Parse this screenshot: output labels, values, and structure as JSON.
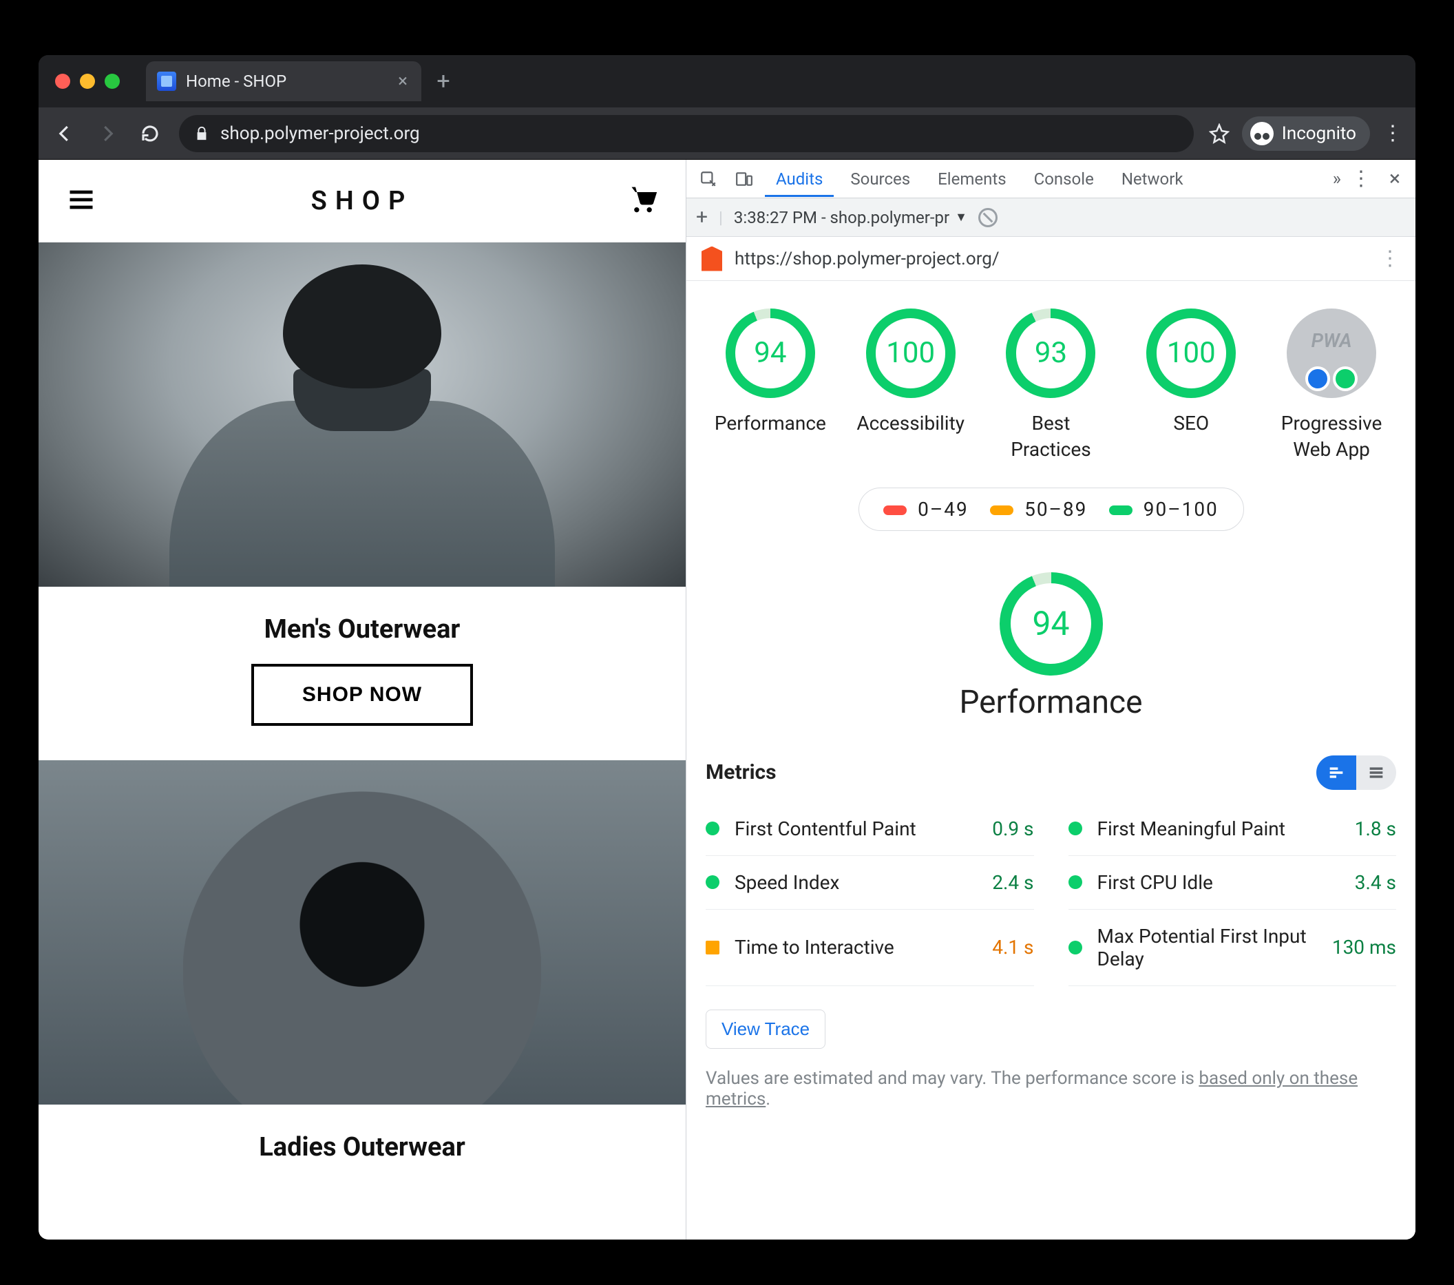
{
  "browser": {
    "tab_title": "Home - SHOP",
    "url": "shop.polymer-project.org",
    "incognito_label": "Incognito"
  },
  "page": {
    "title": "SHOP",
    "sections": [
      {
        "heading": "Men's Outerwear",
        "cta": "SHOP NOW"
      },
      {
        "heading": "Ladies Outerwear"
      }
    ]
  },
  "devtools": {
    "tabs": [
      "Audits",
      "Sources",
      "Elements",
      "Console",
      "Network"
    ],
    "active_tab": "Audits",
    "audit_dropdown": "3:38:27 PM - shop.polymer-pr",
    "audited_url": "https://shop.polymer-project.org/",
    "gauges": [
      {
        "score": 94,
        "label": "Performance"
      },
      {
        "score": 100,
        "label": "Accessibility"
      },
      {
        "score": 93,
        "label": "Best Practices"
      },
      {
        "score": 100,
        "label": "SEO"
      },
      {
        "score": null,
        "label": "Progressive Web App",
        "pwa": true
      }
    ],
    "legend": [
      {
        "color": "red",
        "range": "0–49"
      },
      {
        "color": "orange",
        "range": "50–89"
      },
      {
        "color": "green",
        "range": "90–100"
      }
    ],
    "performance": {
      "score": 94,
      "title": "Performance"
    },
    "metrics_title": "Metrics",
    "metrics_left": [
      {
        "name": "First Contentful Paint",
        "value": "0.9 s",
        "status": "green"
      },
      {
        "name": "Speed Index",
        "value": "2.4 s",
        "status": "green"
      },
      {
        "name": "Time to Interactive",
        "value": "4.1 s",
        "status": "orange"
      }
    ],
    "metrics_right": [
      {
        "name": "First Meaningful Paint",
        "value": "1.8 s",
        "status": "green"
      },
      {
        "name": "First CPU Idle",
        "value": "3.4 s",
        "status": "green"
      },
      {
        "name": "Max Potential First Input Delay",
        "value": "130 ms",
        "status": "green"
      }
    ],
    "view_trace": "View Trace",
    "footnote_pre": "Values are estimated and may vary. The performance score is ",
    "footnote_link": "based only on these metrics",
    "footnote_post": "."
  },
  "colors": {
    "score_green": "#0cce6b",
    "score_orange": "#ffa400",
    "score_red": "#ff4e42"
  }
}
